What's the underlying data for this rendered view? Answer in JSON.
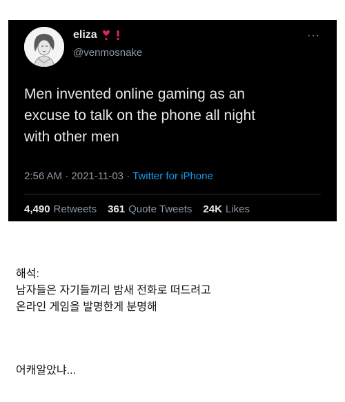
{
  "tweet": {
    "display_name": "eliza",
    "handle": "@venmosnake",
    "more_label": "···",
    "text_lines": [
      "Men invented online gaming as an",
      "excuse to talk on the phone all night",
      "with other men"
    ],
    "time": "2:56 AM",
    "date": "2021-11-03",
    "separator": "·",
    "source": "Twitter for iPhone",
    "retweets_count": "4,490",
    "retweets_label": "Retweets",
    "quotes_count": "361",
    "quotes_label": "Quote Tweets",
    "likes_count": "24K",
    "likes_label": "Likes"
  },
  "caption": {
    "heading": "해석:",
    "line1": "남자들은 자기들끼리 밤새 전화로 떠드려고",
    "line2": "온라인 게임을 발명한게 분명해",
    "trailer": "어캐알았냐..."
  },
  "colors": {
    "tweet_bg": "#000000",
    "link_blue": "#1d9bf0",
    "muted_gray": "#8b98a5",
    "heart_red": "#e0245e"
  },
  "icons": [
    "heart-exclamation-icon",
    "exclamation-icon",
    "more-icon"
  ]
}
